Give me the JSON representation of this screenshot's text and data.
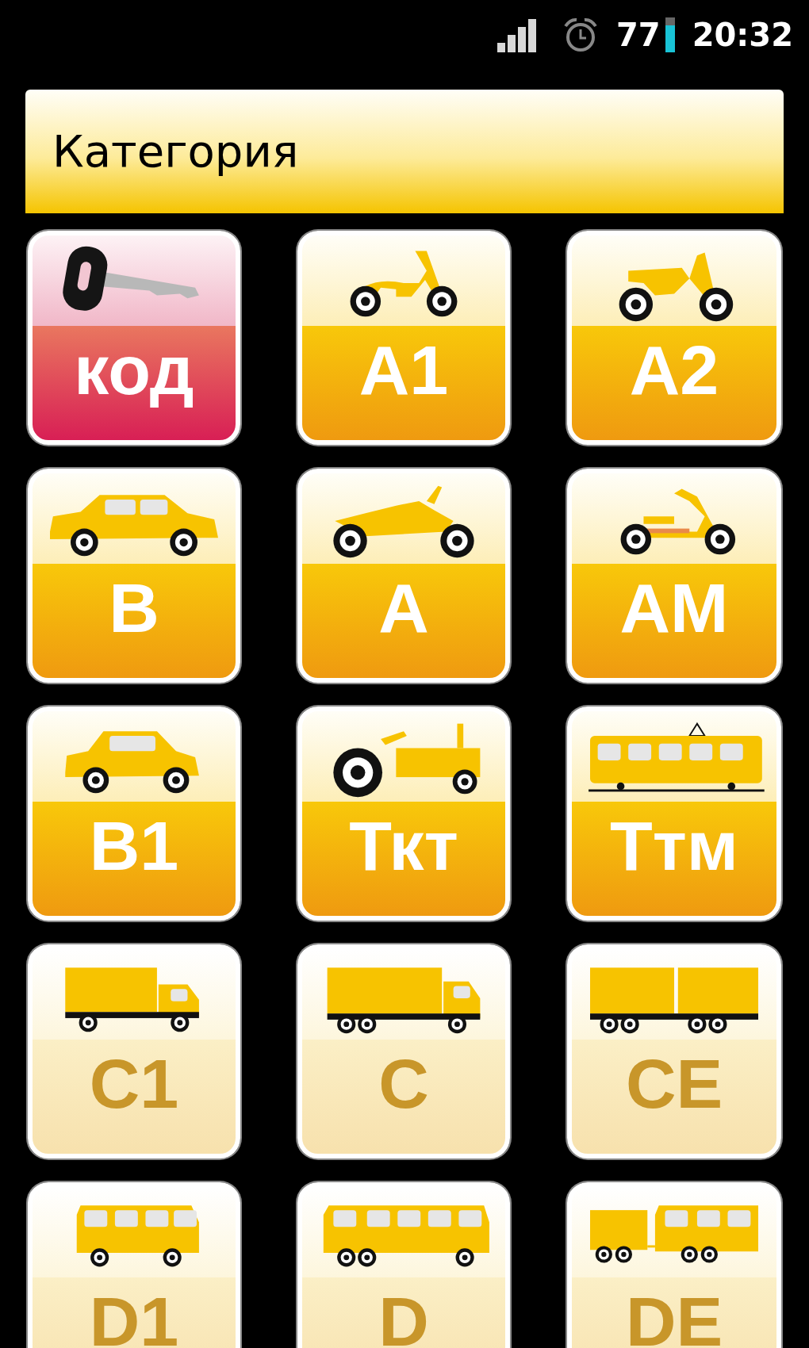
{
  "status_bar": {
    "battery": "77",
    "time": "20:32"
  },
  "header": {
    "title": "Категория"
  },
  "tiles": [
    {
      "label": "код",
      "kind": "key",
      "disabled": false
    },
    {
      "label": "A1",
      "kind": "moped",
      "disabled": false
    },
    {
      "label": "A2",
      "kind": "light-moto",
      "disabled": false
    },
    {
      "label": "B",
      "kind": "car",
      "disabled": false
    },
    {
      "label": "A",
      "kind": "motorcycle",
      "disabled": false
    },
    {
      "label": "AM",
      "kind": "scooter",
      "disabled": false
    },
    {
      "label": "B1",
      "kind": "small-car",
      "disabled": false
    },
    {
      "label": "Ткт",
      "kind": "tractor",
      "disabled": false
    },
    {
      "label": "Ттм",
      "kind": "tram",
      "disabled": false
    },
    {
      "label": "C1",
      "kind": "small-truck",
      "disabled": true
    },
    {
      "label": "C",
      "kind": "truck",
      "disabled": true
    },
    {
      "label": "CE",
      "kind": "road-train",
      "disabled": true
    },
    {
      "label": "D1",
      "kind": "minibus",
      "disabled": true
    },
    {
      "label": "D",
      "kind": "bus",
      "disabled": true
    },
    {
      "label": "DE",
      "kind": "bus-trailer",
      "disabled": true
    }
  ]
}
